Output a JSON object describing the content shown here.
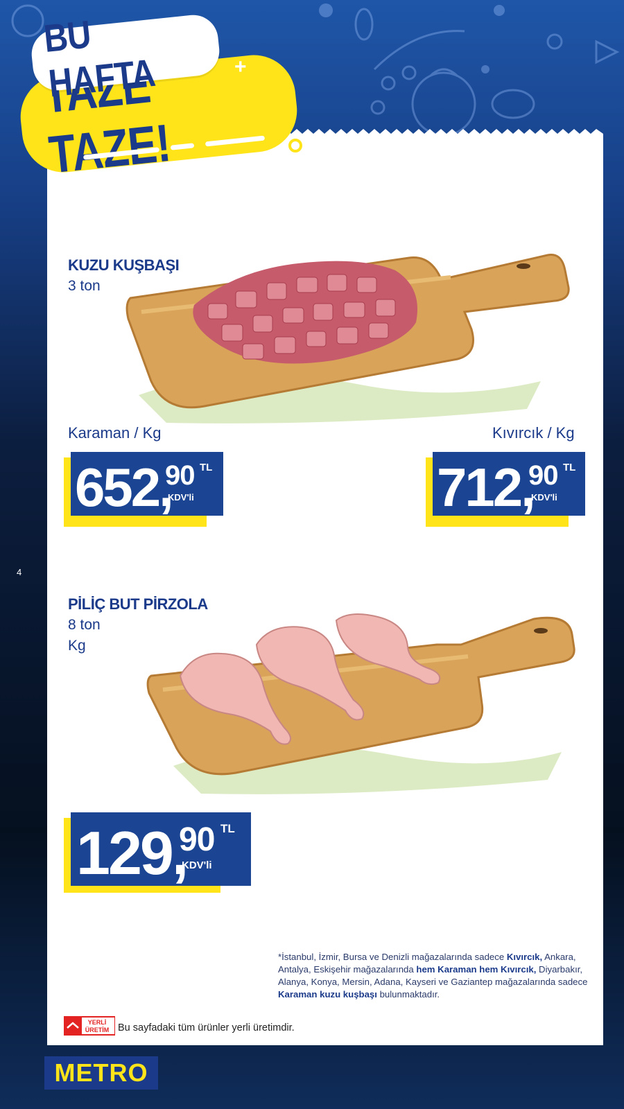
{
  "badge": {
    "line1": "BU HAFTA",
    "line2": "TAZE TAZE!"
  },
  "products": [
    {
      "name": "KUZU KUŞBAŞI",
      "quantity": "3 ton",
      "variants": [
        {
          "label": "Karaman / Kg",
          "price_whole": "652,",
          "price_cents": "90",
          "currency": "TL",
          "tax": "KDV'li"
        },
        {
          "label": "Kıvırcık / Kg",
          "price_whole": "712,",
          "price_cents": "90",
          "currency": "TL",
          "tax": "KDV'li"
        }
      ]
    },
    {
      "name": "PİLİÇ BUT PİRZOLA",
      "quantity": "8 ton",
      "unit": "Kg",
      "price_whole": "129,",
      "price_cents": "90",
      "currency": "TL",
      "tax": "KDV'li"
    }
  ],
  "page_number": "4",
  "footnote": {
    "part1": "*İstanbul, İzmir, Bursa ve Denizli mağazalarında sadece ",
    "bold1": "Kıvırcık,",
    "part2": " Ankara, Antalya, Eskişehir mağazalarında ",
    "bold2": "hem Karaman hem Kıvırcık,",
    "part3": " Diyarbakır, Alanya, Konya, Mersin, Adana, Kayseri ve Gaziantep mağazalarında sadece ",
    "bold3": "Karaman kuzu kuşbaşı",
    "part4": " bulunmaktadır."
  },
  "yerli_uretim": {
    "logo_line1": "YERLİ",
    "logo_line2": "ÜRETİM",
    "text": "Bu sayfadaki tüm ürünler yerli üretimdir."
  },
  "brand": {
    "logo": "METRO",
    "primary": "#1b3a8a",
    "accent": "#ffe419"
  }
}
